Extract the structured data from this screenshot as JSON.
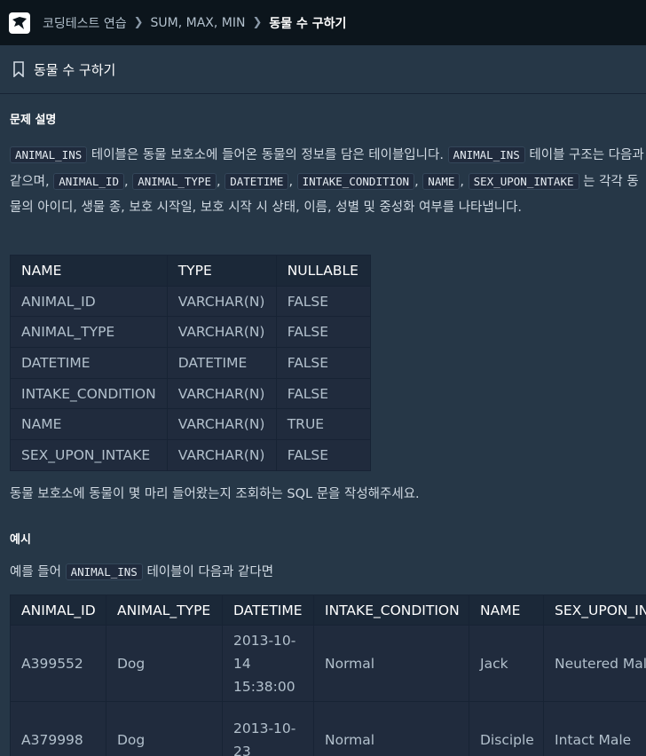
{
  "breadcrumb": [
    "코딩테스트 연습",
    "SUM, MAX, MIN",
    "동물 수 구하기"
  ],
  "title": "동물 수 구하기",
  "section_problem": "문제 설명",
  "desc": {
    "t1": " 테이블은 동물 보호소에 들어온 동물의 정보를 담은 테이블입니다. ",
    "t2": " 테이블 구조는 다음과 같으며, ",
    "t3": " 는 각각 동물의 아이디, 생물 종, 보호 시작일, 보호 시작 시 상태, 이름, 성별 및 중성화 여부를 나타냅니다.",
    "comma": ", "
  },
  "codes": [
    "ANIMAL_INS",
    "ANIMAL_ID",
    "ANIMAL_TYPE",
    "DATETIME",
    "INTAKE_CONDITION",
    "NAME",
    "SEX_UPON_INTAKE"
  ],
  "schema": {
    "headers": [
      "NAME",
      "TYPE",
      "NULLABLE"
    ],
    "rows": [
      [
        "ANIMAL_ID",
        "VARCHAR(N)",
        "FALSE"
      ],
      [
        "ANIMAL_TYPE",
        "VARCHAR(N)",
        "FALSE"
      ],
      [
        "DATETIME",
        "DATETIME",
        "FALSE"
      ],
      [
        "INTAKE_CONDITION",
        "VARCHAR(N)",
        "FALSE"
      ],
      [
        "NAME",
        "VARCHAR(N)",
        "TRUE"
      ],
      [
        "SEX_UPON_INTAKE",
        "VARCHAR(N)",
        "FALSE"
      ]
    ]
  },
  "question": "동물 보호소에 동물이 몇 마리 들어왔는지 조회하는 SQL 문을 작성해주세요.",
  "section_example": "예시",
  "example_intro": {
    "before": "예를 들어 ",
    "code": "ANIMAL_INS",
    "after": " 테이블이 다음과 같다면"
  },
  "example": {
    "headers": [
      "ANIMAL_ID",
      "ANIMAL_TYPE",
      "DATETIME",
      "INTAKE_CONDITION",
      "NAME",
      "SEX_UPON_INTAKE"
    ],
    "rows": [
      [
        "A399552",
        "Dog",
        "2013-10-14 15:38:00",
        "Normal",
        "Jack",
        "Neutered Male"
      ],
      [
        "A379998",
        "Dog",
        "2013-10-23",
        "Normal",
        "Disciple",
        "Intact Male"
      ]
    ]
  }
}
